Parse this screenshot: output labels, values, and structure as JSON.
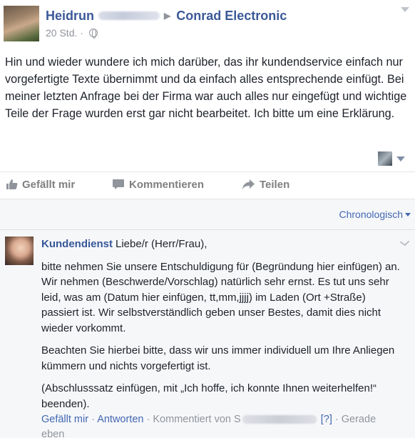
{
  "post": {
    "author": "Heidrun",
    "target_page": "Conrad Electronic",
    "time": "20 Std.",
    "separator": "·",
    "text": "Hin und wieder wundere ich mich darüber, das ihr kundendservice einfach nur vorgefertigte Texte übernimmt und da einfach alles entsprechende einfügt. Bei meiner letzten Anfrage bei der Firma war auch alles nur eingefügt und wichtige Teile der Frage wurden erst gar nicht bearbeitet. Ich bitte um eine Erklärung."
  },
  "actions": {
    "like": "Gefällt mir",
    "comment": "Kommentieren",
    "share": "Teilen"
  },
  "comments_header": {
    "sort_label": "Chronologisch"
  },
  "comment": {
    "author": "Kundendienst",
    "intro": "Liebe/r (Herr/Frau),",
    "paragraphs": [
      "bitte nehmen Sie unsere Entschuldigung für (Begründung hier einfügen) an. Wir nehmen (Beschwerde/Vorschlag) natürlich sehr ernst. Es tut uns sehr leid, was am (Datum hier einfügen, tt,mm,jjjj) im Laden (Ort +Straße) passiert ist. Wir selbstverständlich geben unser Bestes, damit dies nicht wieder vorkommt.",
      "Beachten Sie hierbei bitte, dass wir uns immer individuell um Ihre Anliegen kümmern und nichts vorgefertigt ist.",
      "(Abschlusssatz einfügen, mit „Ich hoffe, ich konnte Ihnen weiterhelfen!“ beenden)."
    ],
    "footer": {
      "like": "Gefällt mir",
      "reply": "Antworten",
      "commented_by": "Kommentiert von S",
      "help_marker": "[?]",
      "status": "Gerade eben"
    }
  },
  "icons": {
    "like": "thumbs-up-icon",
    "comment": "speech-bubble-icon",
    "share": "share-arrow-icon",
    "privacy": "globe-icon"
  },
  "colors": {
    "link": "#3b5998",
    "muted": "#90949c",
    "comment_bg": "#f6f7f9"
  }
}
